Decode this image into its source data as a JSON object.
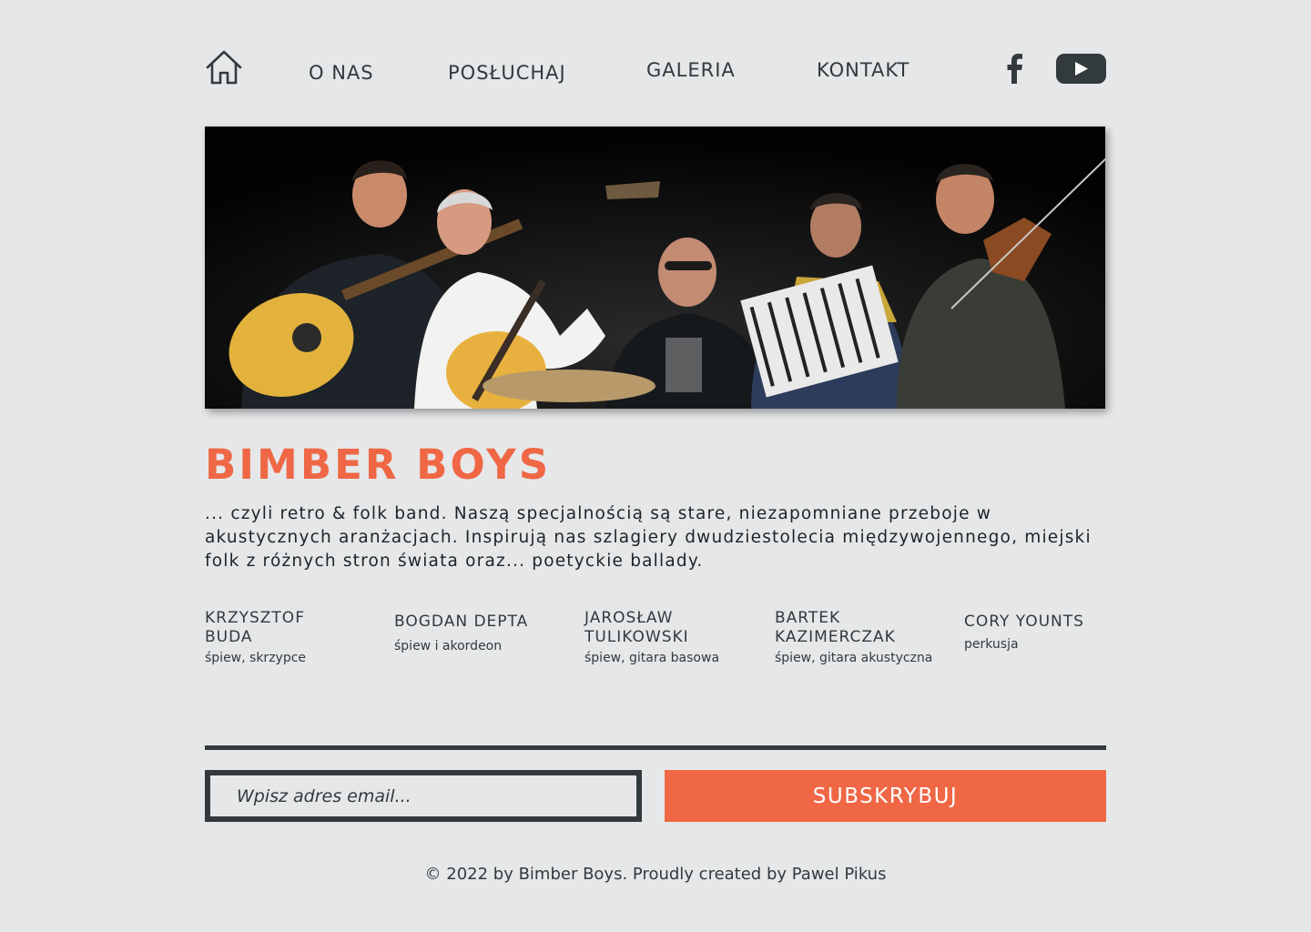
{
  "nav": {
    "home_icon": "home-icon",
    "links": [
      "O NAS",
      "POSŁUCHAJ",
      "GALERIA",
      "KONTAKT"
    ],
    "social": [
      "facebook-icon",
      "youtube-icon"
    ]
  },
  "hero": {
    "image": "band-photo-five-musicians-with-instruments"
  },
  "band": {
    "title": "BIMBER BOYS",
    "description": "... czyli retro & folk band. Naszą specjalnością są stare, niezapomniane przeboje w akustycznych aranżacjach. Inspirują nas szlagiery dwudziestolecia międzywojennego, miejski folk z różnych stron świata oraz... poetyckie ballady."
  },
  "members": [
    {
      "name": "KRZYSZTOF BUDA",
      "role": "śpiew, skrzypce"
    },
    {
      "name": "BOGDAN DEPTA",
      "role": "śpiew i akordeon"
    },
    {
      "name": "JAROSŁAW TULIKOWSKI",
      "role": "śpiew, gitara basowa"
    },
    {
      "name": "BARTEK KAZIMERCZAK",
      "role": "śpiew, gitara akustyczna"
    },
    {
      "name": "CORY YOUNTS",
      "role": "perkusja"
    }
  ],
  "subscribe": {
    "email_placeholder": "Wpisz adres email...",
    "button_label": "SUBSKRYBUJ"
  },
  "footer": {
    "text": "© 2022 by Bimber Boys. Proudly created by Pawel Pikus"
  },
  "colors": {
    "accent": "#ef6745",
    "dark": "#333a3c",
    "background": "#e6e7e9"
  }
}
